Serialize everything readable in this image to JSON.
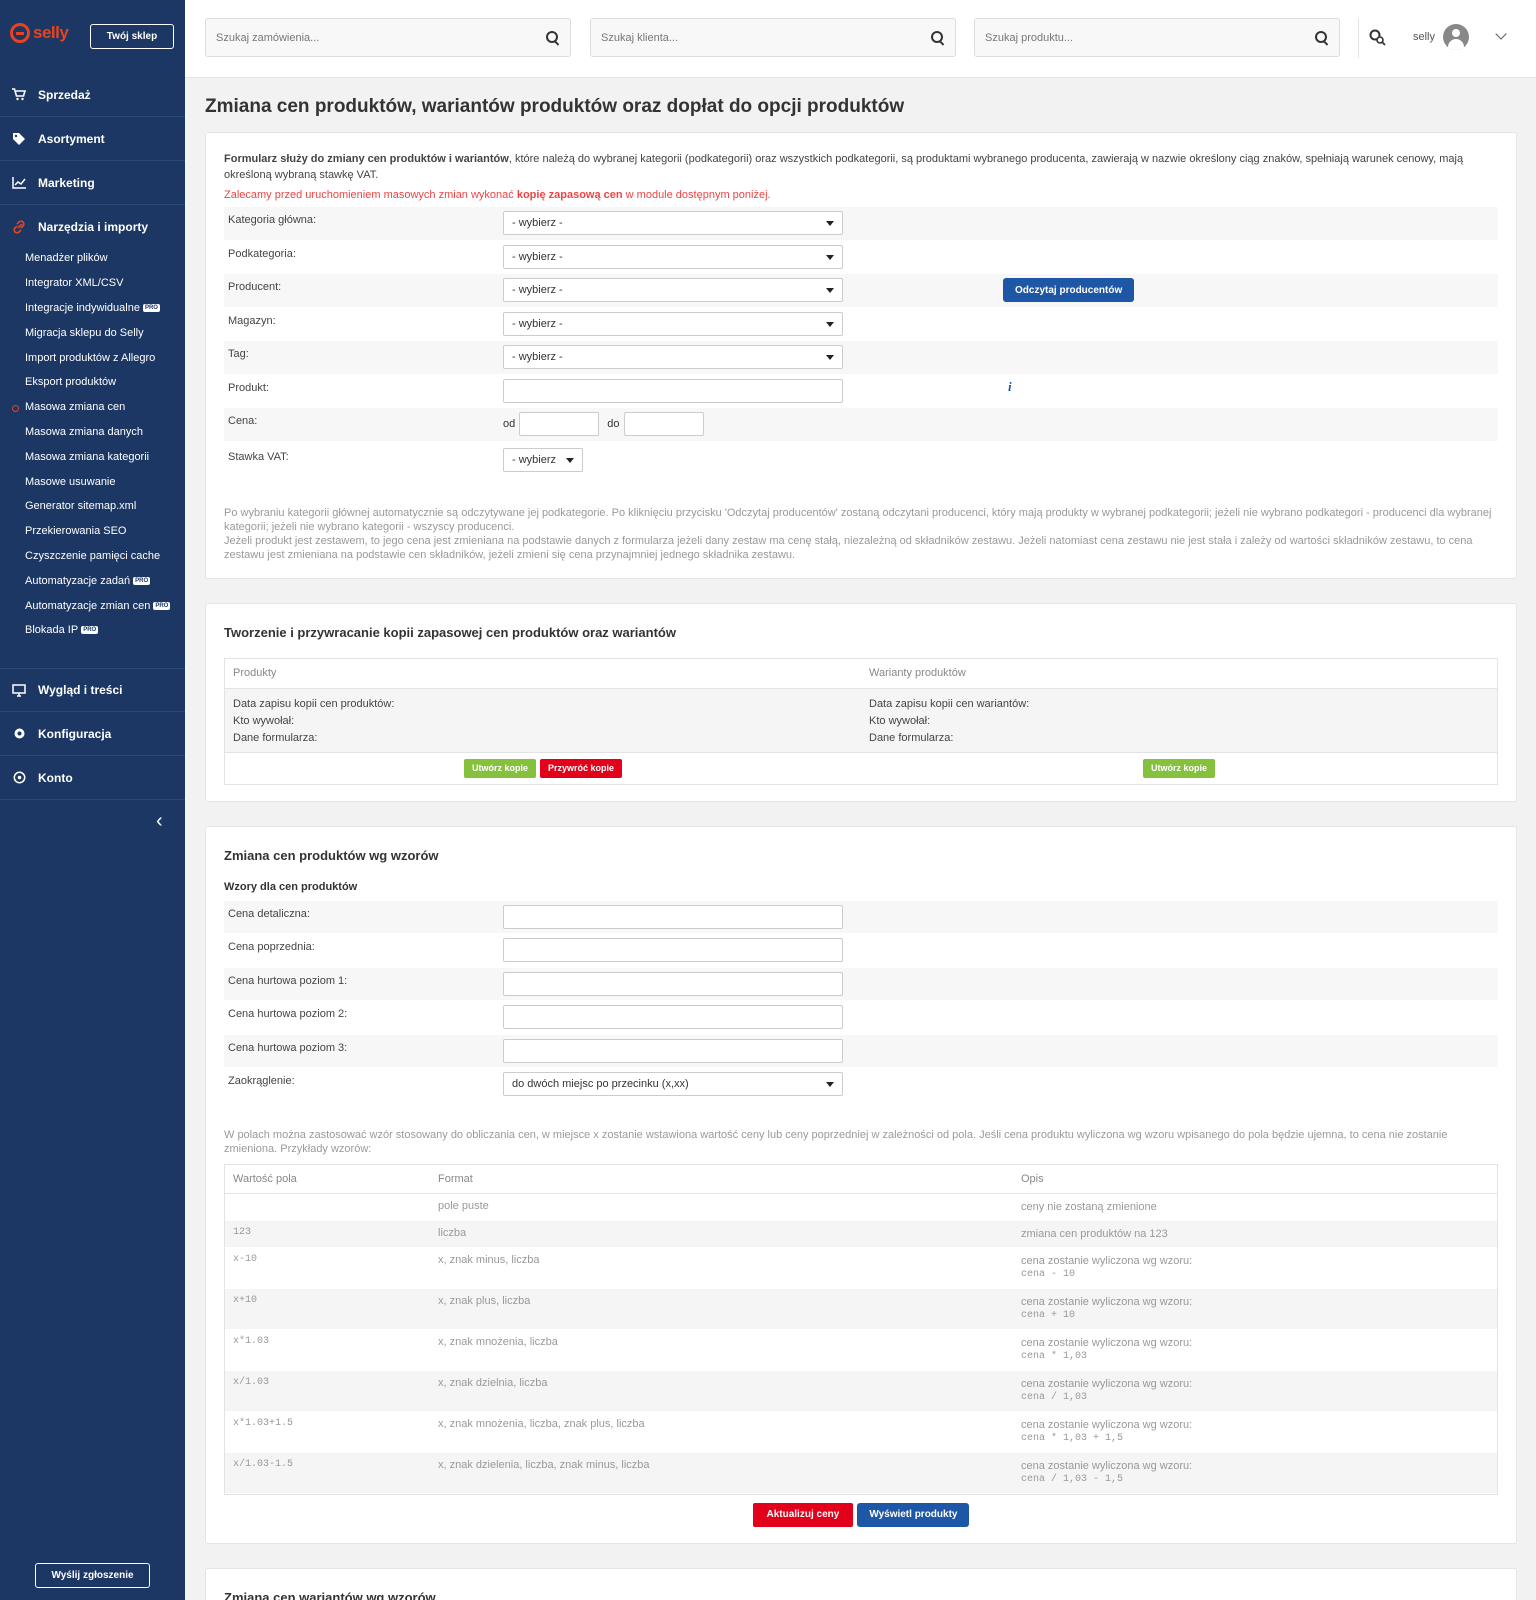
{
  "brand": {
    "logo": "selly",
    "shop_button": "Twój sklep",
    "accent": "#e8431e",
    "sidebar_bg": "#1c3763"
  },
  "sidebar": {
    "main": [
      {
        "label": "Sprzedaż",
        "icon": "cart-icon"
      },
      {
        "label": "Asortyment",
        "icon": "tag-icon"
      },
      {
        "label": "Marketing",
        "icon": "chart-icon"
      },
      {
        "label": "Narzędzia i importy",
        "icon": "link-icon"
      }
    ],
    "sub": [
      {
        "label": "Menadżer plików"
      },
      {
        "label": "Integrator XML/CSV"
      },
      {
        "label": "Integracje indywidualne",
        "pro": "PRO"
      },
      {
        "label": "Migracja sklepu do Selly"
      },
      {
        "label": "Import produktów z Allegro"
      },
      {
        "label": "Eksport produktów"
      },
      {
        "label": "Masowa zmiana cen",
        "active": true
      },
      {
        "label": "Masowa zmiana danych"
      },
      {
        "label": "Masowa zmiana kategorii"
      },
      {
        "label": "Masowe usuwanie"
      },
      {
        "label": "Generator sitemap.xml"
      },
      {
        "label": "Przekierowania SEO"
      },
      {
        "label": "Czyszczenie pamięci cache"
      },
      {
        "label": "Automatyzacje zadań",
        "pro": "PRO"
      },
      {
        "label": "Automatyzacje zmian cen",
        "pro": "PRO"
      },
      {
        "label": "Blokada IP",
        "pro": "PRO"
      }
    ],
    "bottom": [
      {
        "label": "Wygląd i treści",
        "icon": "monitor-icon"
      },
      {
        "label": "Konfiguracja",
        "icon": "gear-icon"
      },
      {
        "label": "Konto",
        "icon": "account-icon"
      }
    ],
    "collapse": "‹",
    "send_button": "Wyślij zgłoszenie"
  },
  "topbar": {
    "search_orders": "Szukaj zamówienia...",
    "search_clients": "Szukaj klienta...",
    "search_products": "Szukaj produktu...",
    "username": "selly"
  },
  "page": {
    "title": "Zmiana cen produktów, wariantów produktów oraz dopłat do opcji produktów"
  },
  "intro": {
    "bold": "Formularz służy do zmiany cen produktów i wariantów",
    "text": ", które należą do wybranej kategorii (podkategorii) oraz wszystkich podkategorii, są produktami wybranego producenta, zawierają w nazwie określony ciąg znaków, spełniają warunek cenowy, mają określoną wybraną stawkę VAT.",
    "warn_pre": "Zalecamy przed uruchomieniem masowych zmian wykonać ",
    "warn_bold": "kopię zapasową cen",
    "warn_post": " w module dostępnym poniżej."
  },
  "filters": {
    "category_label": "Kategoria główna:",
    "category_value": "- wybierz -",
    "subcategory_label": "Podkategoria:",
    "subcategory_value": "- wybierz -",
    "producer_label": "Producent:",
    "producer_value": "- wybierz -",
    "producer_button": "Odczytaj producentów",
    "warehouse_label": "Magazyn:",
    "warehouse_value": "- wybierz -",
    "tag_label": "Tag:",
    "tag_value": "- wybierz -",
    "product_label": "Produkt:",
    "info_icon": "i",
    "price_label": "Cena:",
    "price_from": "od",
    "price_to": "do",
    "vat_label": "Stawka VAT:",
    "vat_value": "- wybierz"
  },
  "filters_note": {
    "p1": "Po wybraniu kategorii głównej automatycznie są odczytywane jej podkategorie. Po kliknięciu przycisku 'Odczytaj producentów' zostaną odczytani producenci, który mają produkty w wybranej podkategorii; jeżeli nie wybrano podkategori - producenci dla wybranej kategorii; jeżeli nie wybrano kategorii - wszyscy producenci.",
    "p2": "Jeżeli produkt jest zestawem, to jego cena jest zmieniana na podstawie danych z formularza jeżeli dany zestaw ma cenę stałą, niezależną od składników zestawu. Jeżeli natomiast cena zestawu nie jest stała i zależy od wartości składników zestawu, to cena zestawu jest zmieniana na podstawie cen składników, jeżeli zmieni się cena przynajmniej jednego składnika zestawu."
  },
  "backup": {
    "title": "Tworzenie i przywracanie kopii zapasowej cen produktów oraz wariantów",
    "col1_head": "Produkty",
    "col2_head": "Warianty produktów",
    "col1_date": "Data zapisu kopii cen produktów:",
    "col2_date": "Data zapisu kopii cen wariantów:",
    "who": "Kto wywołał:",
    "form_data": "Dane formularza:",
    "create": "Utwórz kopie",
    "restore": "Przywróć kopie"
  },
  "formulas": {
    "title": "Zmiana cen produktów wg wzorów",
    "subtitle": "Wzory dla cen produktów",
    "retail": "Cena detaliczna:",
    "previous": "Cena poprzednia:",
    "whole1": "Cena hurtowa poziom 1:",
    "whole2": "Cena hurtowa poziom 2:",
    "whole3": "Cena hurtowa poziom 3:",
    "rounding_label": "Zaokrąglenie:",
    "rounding_value": "do dwóch miejsc po przecinku (x,xx)",
    "note": "W polach można zastosować wzór stosowany do obliczania cen, w miejsce x zostanie wstawiona wartość ceny lub ceny poprzedniej w zależności od pola. Jeśli cena produktu wyliczona wg wzoru wpisanego do pola będzie ujemna, to cena nie zostanie zmieniona. Przykłady wzorów:",
    "head_value": "Wartość pola",
    "head_format": "Format",
    "head_desc": "Opis",
    "examples": [
      {
        "v": "",
        "f": "pole puste",
        "d": "ceny nie zostaną zmienione",
        "m": ""
      },
      {
        "v": "123",
        "f": "liczba",
        "d": "zmiana cen produktów na 123",
        "m": ""
      },
      {
        "v": "x-10",
        "f": "x, znak minus, liczba",
        "d": "cena zostanie wyliczona wg wzoru:",
        "m": "cena - 10"
      },
      {
        "v": "x+10",
        "f": "x, znak plus, liczba",
        "d": "cena zostanie wyliczona wg wzoru:",
        "m": "cena + 10"
      },
      {
        "v": "x*1.03",
        "f": "x, znak mnożenia, liczba",
        "d": "cena zostanie wyliczona wg wzoru:",
        "m": "cena * 1,03"
      },
      {
        "v": "x/1.03",
        "f": "x, znak dzielnia, liczba",
        "d": "cena zostanie wyliczona wg wzoru:",
        "m": "cena / 1,03"
      },
      {
        "v": "x*1.03+1.5",
        "f": "x, znak mnożenia, liczba, znak plus, liczba",
        "d": "cena zostanie wyliczona wg wzoru:",
        "m": "cena * 1,03 + 1,5"
      },
      {
        "v": "x/1.03-1.5",
        "f": "x, znak dzielenia, liczba, znak minus, liczba",
        "d": "cena zostanie wyliczona wg wzoru:",
        "m": "cena / 1,03 - 1,5"
      }
    ],
    "update": "Aktualizuj ceny",
    "show": "Wyświetl produkty"
  },
  "variants": {
    "title": "Zmiana cen wariantów wg wzorów"
  }
}
